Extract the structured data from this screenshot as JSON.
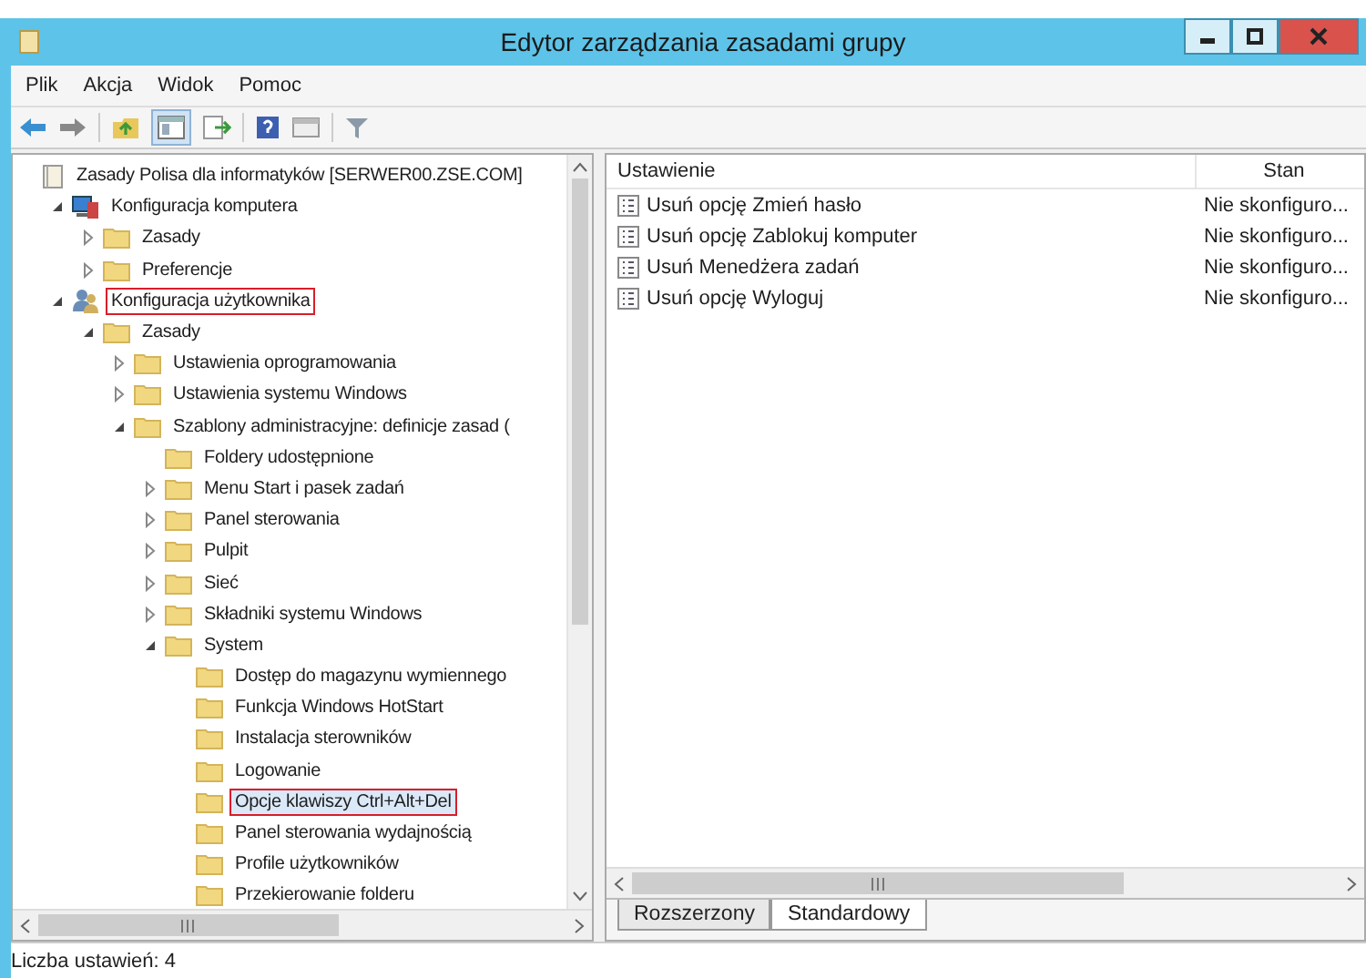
{
  "window": {
    "title": "Edytor zarządzania zasadami grupy"
  },
  "menu": [
    "Plik",
    "Akcja",
    "Widok",
    "Pomoc"
  ],
  "tree": [
    {
      "label": "Zasady Polisa dla informatyków [SERWER00.ZSE.COM]",
      "kind": "root",
      "highlighted": false,
      "selected": false,
      "children": [
        {
          "label": "Konfiguracja komputera",
          "kind": "computer",
          "expanded": true,
          "highlighted": false,
          "selected": false,
          "children": [
            {
              "label": "Zasady",
              "kind": "folder",
              "expanded": false,
              "highlighted": false,
              "selected": false
            },
            {
              "label": "Preferencje",
              "kind": "folder",
              "expanded": false,
              "highlighted": false,
              "selected": false
            }
          ]
        },
        {
          "label": "Konfiguracja użytkownika",
          "kind": "user",
          "expanded": true,
          "highlighted": true,
          "selected": false,
          "children": [
            {
              "label": "Zasady",
              "kind": "folder",
              "expanded": true,
              "highlighted": false,
              "selected": false,
              "children": [
                {
                  "label": "Ustawienia oprogramowania",
                  "kind": "folder",
                  "expanded": false,
                  "highlighted": false,
                  "selected": false
                },
                {
                  "label": "Ustawienia systemu Windows",
                  "kind": "folder",
                  "expanded": false,
                  "highlighted": false,
                  "selected": false
                },
                {
                  "label": "Szablony administracyjne: definicje zasad (",
                  "kind": "folder",
                  "expanded": true,
                  "highlighted": false,
                  "selected": false,
                  "children": [
                    {
                      "label": "Foldery udostępnione",
                      "kind": "folder",
                      "highlighted": false,
                      "selected": false
                    },
                    {
                      "label": "Menu Start i pasek zadań",
                      "kind": "folder",
                      "expanded": false,
                      "highlighted": false,
                      "selected": false
                    },
                    {
                      "label": "Panel sterowania",
                      "kind": "folder",
                      "expanded": false,
                      "highlighted": false,
                      "selected": false
                    },
                    {
                      "label": "Pulpit",
                      "kind": "folder",
                      "expanded": false,
                      "highlighted": false,
                      "selected": false
                    },
                    {
                      "label": "Sieć",
                      "kind": "folder",
                      "expanded": false,
                      "highlighted": false,
                      "selected": false
                    },
                    {
                      "label": "Składniki systemu Windows",
                      "kind": "folder",
                      "expanded": false,
                      "highlighted": false,
                      "selected": false
                    },
                    {
                      "label": "System",
                      "kind": "folder",
                      "expanded": true,
                      "highlighted": false,
                      "selected": false,
                      "children": [
                        {
                          "label": "Dostęp do magazynu wymiennego",
                          "kind": "folder",
                          "highlighted": false,
                          "selected": false
                        },
                        {
                          "label": "Funkcja Windows HotStart",
                          "kind": "folder",
                          "highlighted": false,
                          "selected": false
                        },
                        {
                          "label": "Instalacja sterowników",
                          "kind": "folder",
                          "highlighted": false,
                          "selected": false
                        },
                        {
                          "label": "Logowanie",
                          "kind": "folder",
                          "highlighted": false,
                          "selected": false
                        },
                        {
                          "label": "Opcje klawiszy Ctrl+Alt+Del",
                          "kind": "folder",
                          "highlighted": true,
                          "selected": true
                        },
                        {
                          "label": "Panel sterowania wydajnością",
                          "kind": "folder",
                          "highlighted": false,
                          "selected": false
                        },
                        {
                          "label": "Profile użytkowników",
                          "kind": "folder",
                          "highlighted": false,
                          "selected": false
                        },
                        {
                          "label": "Przekierowanie folderu",
                          "kind": "folder",
                          "highlighted": false,
                          "selected": false
                        }
                      ]
                    }
                  ]
                }
              ]
            }
          ]
        }
      ]
    }
  ],
  "table": {
    "columns": [
      "Ustawienie",
      "Stan"
    ],
    "rows": [
      {
        "setting": "Usuń opcję Zmień hasło",
        "state": "Nie skonfiguro..."
      },
      {
        "setting": "Usuń opcję Zablokuj komputer",
        "state": "Nie skonfiguro..."
      },
      {
        "setting": "Usuń Menedżera zadań",
        "state": "Nie skonfiguro..."
      },
      {
        "setting": "Usuń opcję Wyloguj",
        "state": "Nie skonfiguro..."
      }
    ]
  },
  "view_tabs": [
    {
      "label": "Rozszerzony",
      "selected": false
    },
    {
      "label": "Standardowy",
      "selected": true
    }
  ],
  "status_bar": "Liczba ustawień: 4"
}
